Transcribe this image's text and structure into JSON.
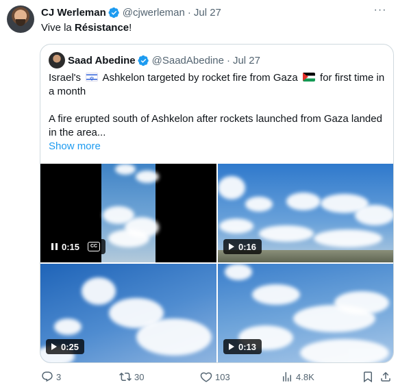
{
  "author": {
    "name": "CJ Werleman",
    "handle": "@cjwerleman",
    "date": "Jul 27"
  },
  "tweet_text_before": "Vive la ",
  "tweet_text_bold": "Résistance",
  "tweet_text_after": "!",
  "quote": {
    "author": {
      "name": "Saad Abedine",
      "handle": "@SaadAbedine",
      "date": "Jul 27"
    },
    "line1_a": "Israel's ",
    "line1_b": " Ashkelon targeted by rocket fire from Gaza ",
    "line1_c": " for first time in a month",
    "line2": "A fire erupted south of Ashkelon after rockets launched from Gaza landed in the area...",
    "show_more": "Show more",
    "videos": [
      {
        "duration": "0:15",
        "state": "paused-icon",
        "cc": "CC"
      },
      {
        "duration": "0:16",
        "state": "play-icon"
      },
      {
        "duration": "0:25",
        "state": "play-icon"
      },
      {
        "duration": "0:13",
        "state": "play-icon"
      }
    ]
  },
  "separator": "·",
  "actions": {
    "replies": "3",
    "reposts": "30",
    "likes": "103",
    "views": "4.8K"
  },
  "colors": {
    "link": "#1d9bf0",
    "secondary": "#536471",
    "verified": "#1d9bf0"
  }
}
